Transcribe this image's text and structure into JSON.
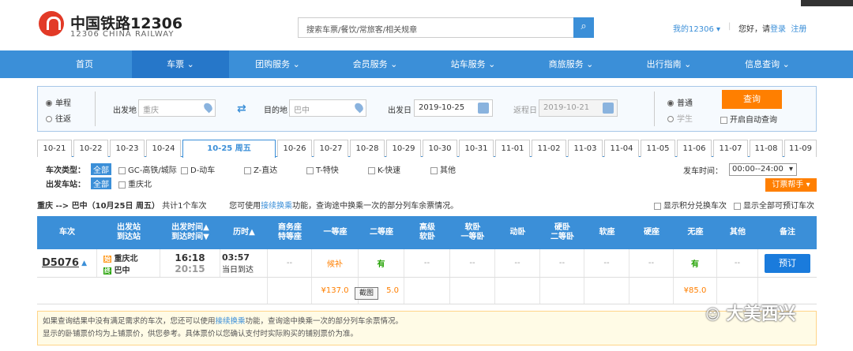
{
  "header": {
    "logo_cn": "中国铁路12306",
    "logo_en": "12306 CHINA RAILWAY",
    "search_placeholder": "搜索车票/餐饮/常旅客/相关规章",
    "my12306": "我的12306",
    "hello": "您好，请",
    "login": "登录",
    "register": "注册"
  },
  "nav": [
    "首页",
    "车票 ⌄",
    "团购服务 ⌄",
    "会员服务 ⌄",
    "站车服务 ⌄",
    "商旅服务 ⌄",
    "出行指南 ⌄",
    "信息查询 ⌄"
  ],
  "query": {
    "oneway": "单程",
    "roundtrip": "往返",
    "from_label": "出发地",
    "from_value": "重庆",
    "to_label": "目的地",
    "to_value": "巴中",
    "depart_label": "出发日",
    "depart_value": "2019-10-25",
    "return_label": "返程日",
    "return_value": "2019-10-21",
    "normal": "普通",
    "student": "学生",
    "search_btn": "查询",
    "auto_query": "开启自动查询"
  },
  "dates": [
    "10-21",
    "10-22",
    "10-23",
    "10-24",
    "10-25 周五",
    "10-26",
    "10-27",
    "10-28",
    "10-29",
    "10-30",
    "10-31",
    "11-01",
    "11-02",
    "11-03",
    "11-04",
    "11-05",
    "11-06",
    "11-07",
    "11-08",
    "11-09"
  ],
  "filters": {
    "type_label": "车次类型：",
    "all": "全部",
    "types": [
      "GC-高铁/城际",
      "D-动车",
      "Z-直达",
      "T-特快",
      "K-快速",
      "其他"
    ],
    "station_label": "出发车站：",
    "stations": [
      "重庆北"
    ],
    "time_label": "发车时间：",
    "time_value": "00:00--24:00",
    "help": "订票帮手 ▾"
  },
  "summary": {
    "route": "重庆 --> 巴中（10月25日 周五）",
    "count": "共计1个车次",
    "hint_pre": "您可使用",
    "hint_link": "接续换乘",
    "hint_post": "功能，查询途中换乘一次的部分列车余票情况。",
    "opt1": "显示积分兑换车次",
    "opt2": "显示全部可预订车次"
  },
  "table": {
    "headers": [
      "车次",
      "出发站\n到达站",
      "出发时间▲\n到达时间▼",
      "历时▲",
      "商务座\n特等座",
      "一等座",
      "二等座",
      "高级\n软卧",
      "软卧\n一等卧",
      "动卧",
      "硬卧\n二等卧",
      "软座",
      "硬座",
      "无座",
      "其他",
      "备注"
    ],
    "train": "D5076",
    "from_station": "重庆北",
    "to_station": "巴中",
    "from_tag": "始",
    "to_tag": "终",
    "depart": "16:18",
    "arrive": "20:15",
    "duration": "03:57",
    "arrive_note": "当日到达",
    "cells": [
      "--",
      "候补",
      "有",
      "--",
      "--",
      "--",
      "--",
      "--",
      "--",
      "有",
      "--"
    ],
    "book": "预订",
    "price_first": "¥137.0",
    "price_second_partial": "5.0",
    "price_noseat": "¥85.0",
    "tooltip": "截图"
  },
  "notice": {
    "line1_pre": "如果查询结果中没有满足需求的车次，您还可以使用",
    "line1_link": "接续换乘",
    "line1_post": "功能，查询途中换乘一次的部分列车余票情况。",
    "line2": "显示的卧铺票价均为上铺票价，供您参考。具体票价以您确认支付时实际购买的铺别票价为准。"
  },
  "watermark": "大美西兴"
}
